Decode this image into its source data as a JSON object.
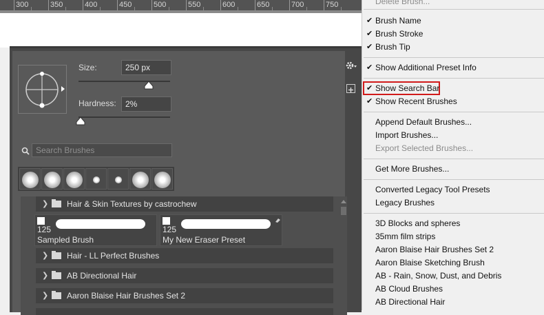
{
  "ruler": {
    "labels": [
      "300",
      "350",
      "400",
      "450",
      "500",
      "550",
      "600",
      "650",
      "700",
      "750"
    ]
  },
  "brush_panel": {
    "size_label": "Size:",
    "size_value": "250 px",
    "hardness_label": "Hardness:",
    "hardness_value": "2%",
    "search_placeholder": "Search Brushes",
    "groups": [
      {
        "name": "Hair & Skin Textures by castrochew"
      },
      {
        "name": "Hair - LL Perfect Brushes"
      },
      {
        "name": "AB Directional Hair"
      },
      {
        "name": "Aaron Blaise Hair Brushes Set 2"
      }
    ],
    "brushes": [
      {
        "size": "125",
        "name": "Sampled Brush"
      },
      {
        "size": "125",
        "name": "My New Eraser Preset"
      }
    ]
  },
  "menu": {
    "partial_top": "Delete Brush...",
    "items": [
      {
        "label": "Brush Name",
        "checked": true
      },
      {
        "label": "Brush Stroke",
        "checked": true
      },
      {
        "label": "Brush Tip",
        "checked": true
      },
      {
        "label": "Show Additional Preset Info",
        "checked": true
      },
      {
        "label": "Show Search Bar",
        "checked": true
      },
      {
        "label": "Show Recent Brushes",
        "checked": true
      },
      {
        "label": "Append Default Brushes..."
      },
      {
        "label": "Import Brushes..."
      },
      {
        "label": "Export Selected Brushes...",
        "disabled": true
      },
      {
        "label": "Get More Brushes..."
      },
      {
        "label": "Converted Legacy Tool Presets"
      },
      {
        "label": "Legacy Brushes"
      },
      {
        "label": "3D Blocks and spheres"
      },
      {
        "label": "35mm film strips"
      },
      {
        "label": "Aaron Blaise Hair Brushes Set 2"
      },
      {
        "label": "Aaron Blaise Sketching Brush"
      },
      {
        "label": "AB - Rain, Snow, Dust, and Debris"
      },
      {
        "label": "AB Cloud Brushes"
      },
      {
        "label": "AB Directional Hair"
      }
    ],
    "highlight_color": "#d11a1a"
  }
}
